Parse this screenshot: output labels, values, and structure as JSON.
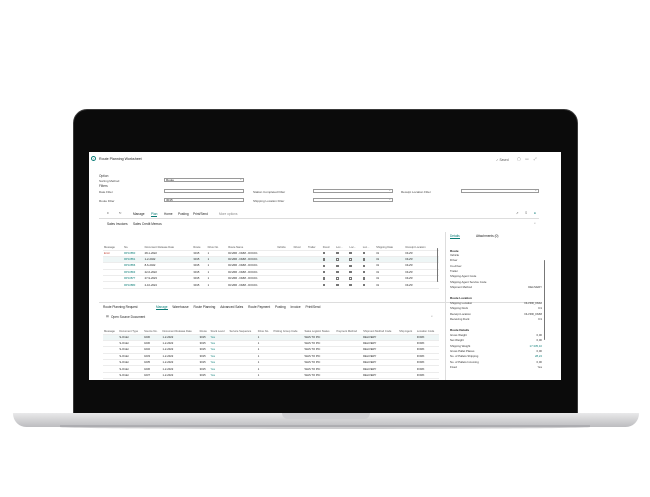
{
  "window": {
    "title": "Route Planning Worksheet",
    "saved": "✓ Saved"
  },
  "options": {
    "section": "Option",
    "sorting_label": "Sorting Method",
    "sorting_value": "Route",
    "filters": "Filters",
    "date_filter": "Date Filter",
    "route_filter": "Route Filter",
    "route_filter_value": "3015",
    "station_filter": "Station Completed Filter",
    "shipping_location_filter": "Shipping Location Filter",
    "receipt_location_filter": "Receipt Location Filter"
  },
  "toolbar": {
    "manage": "Manage",
    "plan": "Plan",
    "home": "Home",
    "posting": "Posting",
    "print_send": "Print/Send",
    "more": "More options",
    "sales_invoices": "Sales Invoices",
    "sales_credit_memos": "Sales Credit Memos"
  },
  "upper_table": {
    "headers": [
      "Message",
      "No.",
      "Document Release Date",
      "Route",
      "Drive No.",
      "Route Name",
      "Vehicle",
      "Driver",
      "Trailer",
      "Fixed",
      "Loc...",
      "Loc...",
      "Loc...",
      "Shipping Date",
      "Receipt Location"
    ],
    "rows": [
      [
        "Error",
        "RP10850",
        "28-1-2022",
        "3015",
        "1",
        "DLVRR - DMM - DOCK1",
        "",
        "",
        "",
        "",
        "",
        "",
        "",
        "31",
        "DLVR"
      ],
      [
        "",
        "RP10851",
        "1-2-2022",
        "3015",
        "1",
        "DLVRR - DMM - DOCK1",
        "",
        "",
        "",
        "",
        "",
        "",
        "",
        "31",
        "DLVR"
      ],
      [
        "",
        "RP10856",
        "8-6-2022",
        "3015",
        "1",
        "DLVRR - DMM - DOCK1",
        "",
        "",
        "",
        "",
        "",
        "",
        "",
        "31",
        "DLVR"
      ],
      [
        "",
        "RP10863",
        "22-6-2022",
        "3015",
        "1",
        "DLVRR - DMM - DOCK1",
        "",
        "",
        "",
        "",
        "",
        "",
        "",
        "31",
        "DLVR"
      ],
      [
        "",
        "RP10877",
        "27-9-2023",
        "3015",
        "1",
        "DLVRR - DMM - DOCK1",
        "",
        "",
        "",
        "",
        "",
        "",
        "",
        "31",
        "DLVR"
      ],
      [
        "",
        "RP10880",
        "2-10-2024",
        "3015",
        "1",
        "DLVRR - DMM - DOCK1",
        "",
        "",
        "",
        "",
        "",
        "",
        "",
        "31",
        "DLVR"
      ]
    ]
  },
  "lower": {
    "title": "Route Planning Request",
    "tabs": [
      "Manage",
      "Warehouse",
      "Route Planning",
      "Advanced Sales",
      "Route Payment",
      "Posting",
      "Invoice",
      "Print/Send"
    ],
    "open_source": "Open Source Document",
    "headers": [
      "Message",
      "Document Type",
      "Source No.",
      "Document Release Date",
      "Route",
      "Stock Level",
      "Service Sequence",
      "Drive No.",
      "Picking Group Code",
      "Sales Logistic Status",
      "Payment Method",
      "Shipment Method Code",
      "Ship Agent",
      "Location Code"
    ],
    "rows": [
      [
        "",
        "S-Order",
        "1030",
        "1-2-2022",
        "3015",
        "Yes",
        "",
        "1",
        "",
        "WHS TO PIC",
        "",
        "DELIVERY",
        "",
        "FORK"
      ],
      [
        "",
        "S-Order",
        "1030",
        "1-2-2022",
        "3015",
        "Yes",
        "",
        "1",
        "",
        "WHS TO PIC",
        "",
        "DELIVERY",
        "",
        "FORK"
      ],
      [
        "",
        "S-Order",
        "1032",
        "1-2-2022",
        "3015",
        "Yes",
        "",
        "1",
        "",
        "WHS TO PIC",
        "",
        "DELIVERY",
        "",
        "FORK"
      ],
      [
        "",
        "S-Order",
        "1033",
        "1-2-2022",
        "3015",
        "Yes",
        "",
        "1",
        "",
        "WHS TO PIC",
        "",
        "DELIVERY",
        "",
        "FORK"
      ],
      [
        "",
        "S-Order",
        "1035",
        "1-2-2022",
        "3015",
        "Yes",
        "",
        "1",
        "",
        "WHS TO PIC",
        "",
        "DELIVERY",
        "",
        "FORK"
      ],
      [
        "",
        "S-Order",
        "1036",
        "1-2-2022",
        "3015",
        "Yes",
        "",
        "1",
        "",
        "WHS TO PIC",
        "",
        "DELIVERY",
        "",
        "FORK"
      ],
      [
        "",
        "S-Order",
        "1037",
        "1-2-2022",
        "3015",
        "Yes",
        "",
        "1",
        "",
        "WHS TO PIC",
        "",
        "DELIVERY",
        "",
        "FORK"
      ]
    ]
  },
  "factbox": {
    "tab_details": "Details",
    "tab_attachments": "Attachments (0)",
    "route_h": "Route",
    "route_lines": [
      "Vehicle",
      "Driver",
      "Co-driver",
      "Trailer",
      "Shipping Agent Code",
      "Shipping Agent Service Code",
      "Shipment Method"
    ],
    "shipment_method": "DELIVERY",
    "location_h": "Route Location",
    "location_lines": [
      {
        "k": "Shipping Location",
        "v": "DLVRR_DMM"
      },
      {
        "k": "Shipping Dock",
        "v": "D1"
      },
      {
        "k": "Receipt Location",
        "v": "DLVRR_DMM"
      },
      {
        "k": "Receiving Dock",
        "v": "D1"
      }
    ],
    "details_h": "Route Details",
    "details_lines": [
      {
        "k": "Gross Weight",
        "v": "0,00"
      },
      {
        "k": "Net Weight",
        "v": "0,00"
      },
      {
        "k": "Shipping Weight",
        "v": "17.335,10"
      },
      {
        "k": "Gross Pallet Places",
        "v": "0,00"
      },
      {
        "k": "No. of Pallets Shipping",
        "v": "28,22"
      },
      {
        "k": "No. of Pallets Incoming",
        "v": "0,00"
      },
      {
        "k": "Fixed",
        "v": "Yes"
      }
    ]
  }
}
